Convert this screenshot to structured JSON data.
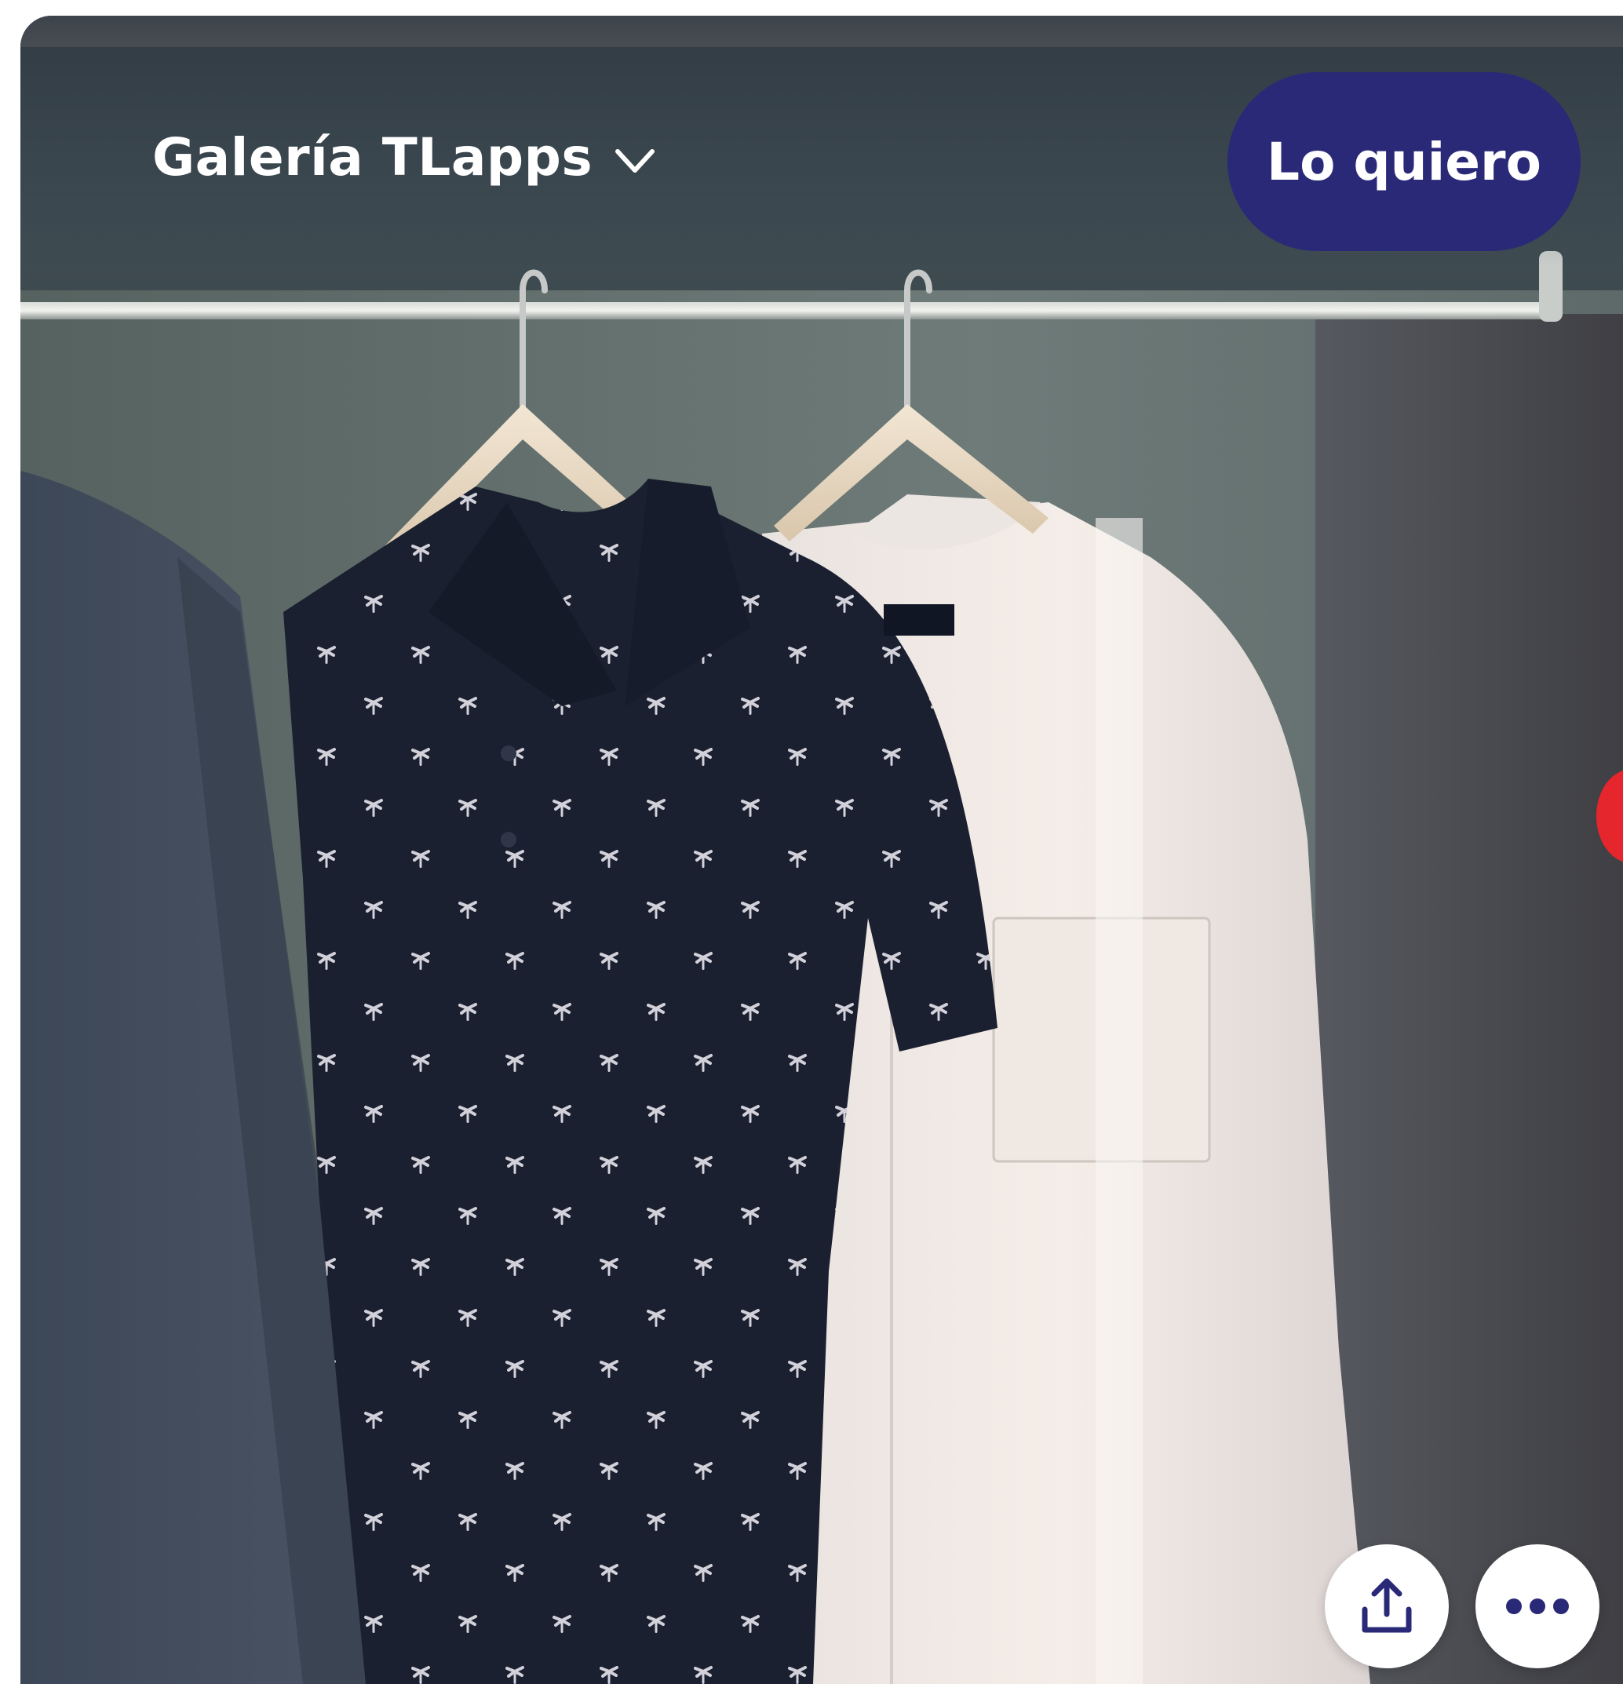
{
  "header": {
    "gallery_title": "Galería TLapps",
    "dropdown_icon": "chevron-down-icon",
    "cta_label": "Lo quiero"
  },
  "actions": {
    "share_icon": "share-upload-icon",
    "more_icon": "more-horizontal-icon"
  },
  "image": {
    "subject": "clothes-hanging-in-closet"
  },
  "colors": {
    "cta_background": "#2a2978",
    "icon_color": "#2a2978",
    "edge_badge": "#e5262c"
  }
}
